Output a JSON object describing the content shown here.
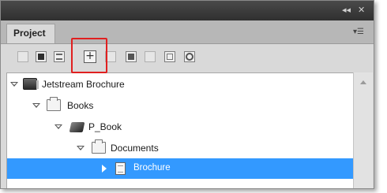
{
  "window": {
    "collapse_glyph": "◂◂",
    "close_glyph": "✕",
    "menu_glyph": "▾☰"
  },
  "panel": {
    "tab_label": "Project"
  },
  "toolbar": {
    "buttons": [
      {
        "icon": "document-icon"
      },
      {
        "icon": "save-icon"
      },
      {
        "icon": "list-icon"
      },
      {
        "icon": "add-icon",
        "highlighted": true
      },
      {
        "icon": "blank-icon"
      },
      {
        "icon": "remove-icon"
      },
      {
        "icon": "page-icon"
      },
      {
        "icon": "properties-icon"
      },
      {
        "icon": "refresh-icon"
      }
    ],
    "highlight_color": "#e02020"
  },
  "tree": {
    "items": [
      {
        "label": "Jetstream Brochure",
        "icon": "project-book-icon",
        "expanded": true,
        "level": 0
      },
      {
        "label": "Books",
        "icon": "folder-icon",
        "expanded": true,
        "level": 1
      },
      {
        "label": "P_Book",
        "icon": "book-icon",
        "expanded": true,
        "level": 2
      },
      {
        "label": "Documents",
        "icon": "folder-icon",
        "expanded": true,
        "level": 3
      },
      {
        "label": "Brochure",
        "icon": "document-icon",
        "expanded": false,
        "level": 4,
        "selected": true
      }
    ],
    "selection_color": "#3399ff"
  }
}
